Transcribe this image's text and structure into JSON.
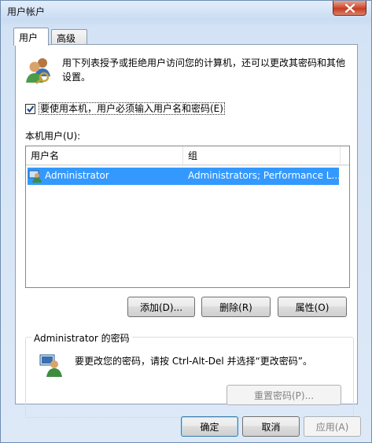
{
  "window": {
    "title": "用户帐户",
    "close_icon": "close-icon"
  },
  "tabs": [
    {
      "label": "用户",
      "active": true
    },
    {
      "label": "高级",
      "active": false
    }
  ],
  "intro": {
    "icon": "users-icon",
    "text": "用下列表授予或拒绝用户访问您的计算机，还可以更改其密码和其他设置。"
  },
  "require_login": {
    "checked": true,
    "label": "要使用本机，用户必须输入用户名和密码(E)"
  },
  "local_users": {
    "label": "本机用户(U):",
    "columns": [
      "用户名",
      "组"
    ],
    "rows": [
      {
        "icon": "user-icon",
        "username": "Administrator",
        "group": "Administrators; Performance L...",
        "selected": true
      }
    ]
  },
  "user_buttons": {
    "add": "添加(D)...",
    "remove": "删除(R)",
    "properties": "属性(O)"
  },
  "password_group": {
    "title": "Administrator 的密码",
    "icon": "user-key-icon",
    "text": "要更改您的密码，请按 Ctrl-Alt-Del 并选择“更改密码”。",
    "reset_button": "重置密码(P)..."
  },
  "dialog_buttons": {
    "ok": "确定",
    "cancel": "取消",
    "apply": "应用(A)"
  },
  "colors": {
    "selection": "#3399ff",
    "frame": "#c9dcf2"
  }
}
